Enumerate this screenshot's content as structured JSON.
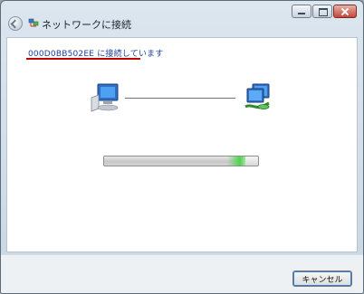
{
  "window": {
    "title": "ネットワークに接続",
    "controls": [
      "minimize",
      "maximize",
      "close"
    ]
  },
  "main": {
    "status_text": "000D0BB502EE に接続しています",
    "left_icon": "computer-icon",
    "right_icon": "network-icon",
    "progress": {
      "state": "indeterminate",
      "highlight_position": 0.92
    }
  },
  "footer": {
    "cancel_label": "キャンセル"
  },
  "colors": {
    "heading": "#1a3f9b",
    "underline": "#c00000",
    "progress_glow": "#4fd24f"
  }
}
